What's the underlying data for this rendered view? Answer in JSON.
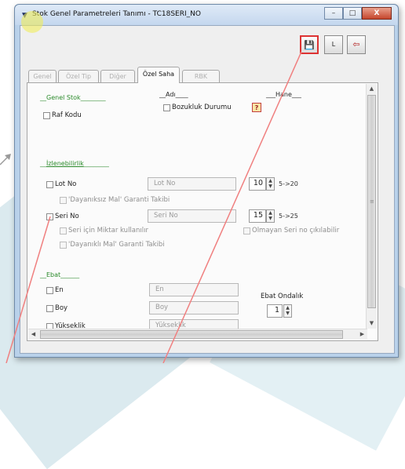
{
  "window": {
    "title": "Stok Genel Parametreleri Tanımı - TC18SERI_NO",
    "minimize": "–",
    "maximize": "□",
    "close": "X"
  },
  "toolbar": {
    "save_icon": "save-icon",
    "l_label": "L",
    "exit_icon": "exit-door-icon"
  },
  "tabs": [
    {
      "label": "Genel",
      "active": false
    },
    {
      "label": "Özel Tip",
      "active": false
    },
    {
      "label": "Diğer",
      "active": false
    },
    {
      "label": "Özel Saha",
      "active": true
    },
    {
      "label": "RBK",
      "active": false
    }
  ],
  "genel_stok": {
    "group_title": "Genel Stok",
    "adi_header": "Adı",
    "hane_header": "Hane",
    "raf_kodu": "Raf Kodu",
    "bozukluk_durumu": "Bozukluk Durumu",
    "help": "?"
  },
  "izlenebilirlik": {
    "group_title": "İzlenebilirlik",
    "lot_no_label": "Lot No",
    "lot_no_value": "Lot No",
    "lot_hane": "10",
    "lot_range": "5->20",
    "dayaniksiz_garanti": "'Dayanıksız Mal' Garanti Takibi",
    "seri_no_label": "Seri No",
    "seri_no_value": "Seri No",
    "seri_hane": "15",
    "seri_range": "5->25",
    "seri_miktar": "Seri için Miktar kullanılır",
    "olmayan_seri": "Olmayan Seri no çıkılabilir",
    "dayanikli_garanti": "'Dayanıklı Mal' Garanti Takibi"
  },
  "ebat": {
    "group_title": "Ebat",
    "en_label": "En",
    "en_value": "En",
    "boy_label": "Boy",
    "boy_value": "Boy",
    "yukseklik_label": "Yükseklik",
    "yukseklik_value": "Yükseklik",
    "ondalik_label": "Ebat Ondalık",
    "ondalik_value": "1"
  },
  "colors": {
    "group_title": "#2a8a2a",
    "annotation_arrow": "#f08080",
    "highlight": "#f0ec5a"
  }
}
